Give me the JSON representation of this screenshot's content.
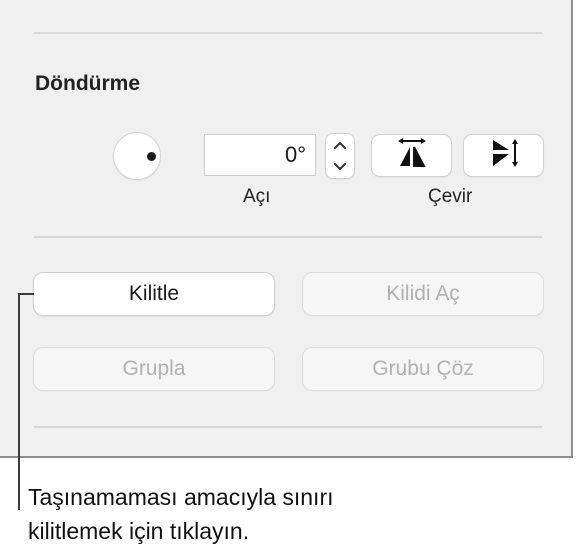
{
  "rotation": {
    "title": "Döndürme",
    "angle_value": "0°",
    "angle_label": "Açı",
    "flip_label": "Çevir"
  },
  "buttons": {
    "lock": "Kilitle",
    "unlock": "Kilidi Aç",
    "group": "Grupla",
    "ungroup": "Grubu Çöz"
  },
  "caption": {
    "line1": "Taşınamaması amacıyla sınırı",
    "line2": "kilitlemek için tıklayın."
  },
  "icons": {
    "rotate": "rotation-knob-icon",
    "stepper_up": "chevron-up-icon",
    "stepper_down": "chevron-down-icon",
    "flip_vertical": "flip-vertical-icon",
    "flip_horizontal": "flip-horizontal-icon"
  },
  "colors": {
    "panel_bg": "#f0f0f0",
    "disabled_text": "#b2b2b2"
  }
}
